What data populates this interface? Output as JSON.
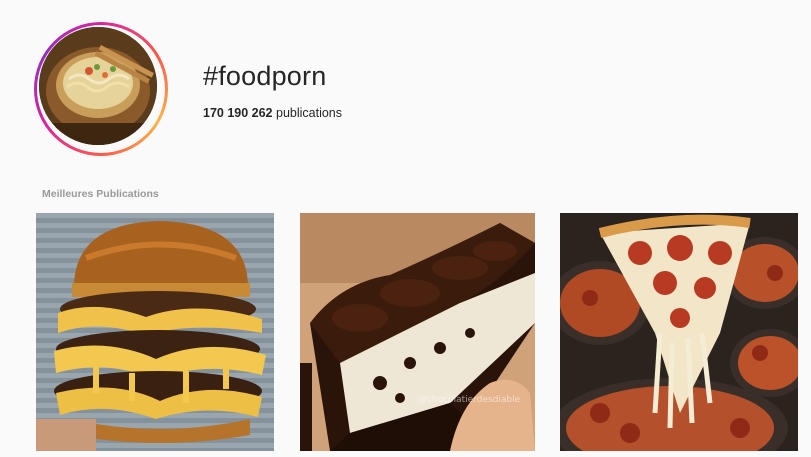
{
  "profile": {
    "hashtag": "#foodporn",
    "post_count": "170 190 262",
    "post_count_suffix": " publications",
    "avatar_icon": "noodle-bowl-photo"
  },
  "top_posts": {
    "title": "Meilleures Publications",
    "items": [
      {
        "subject": "burger-photo"
      },
      {
        "subject": "chocolate-cake-photo",
        "watermark": "@chocolatierdesdiable"
      },
      {
        "subject": "pizza-photo"
      }
    ]
  },
  "colors": {
    "ring_start": "#d6249f",
    "ring_end": "#fdb54a",
    "background": "#fafafa",
    "muted_text": "#999999"
  }
}
